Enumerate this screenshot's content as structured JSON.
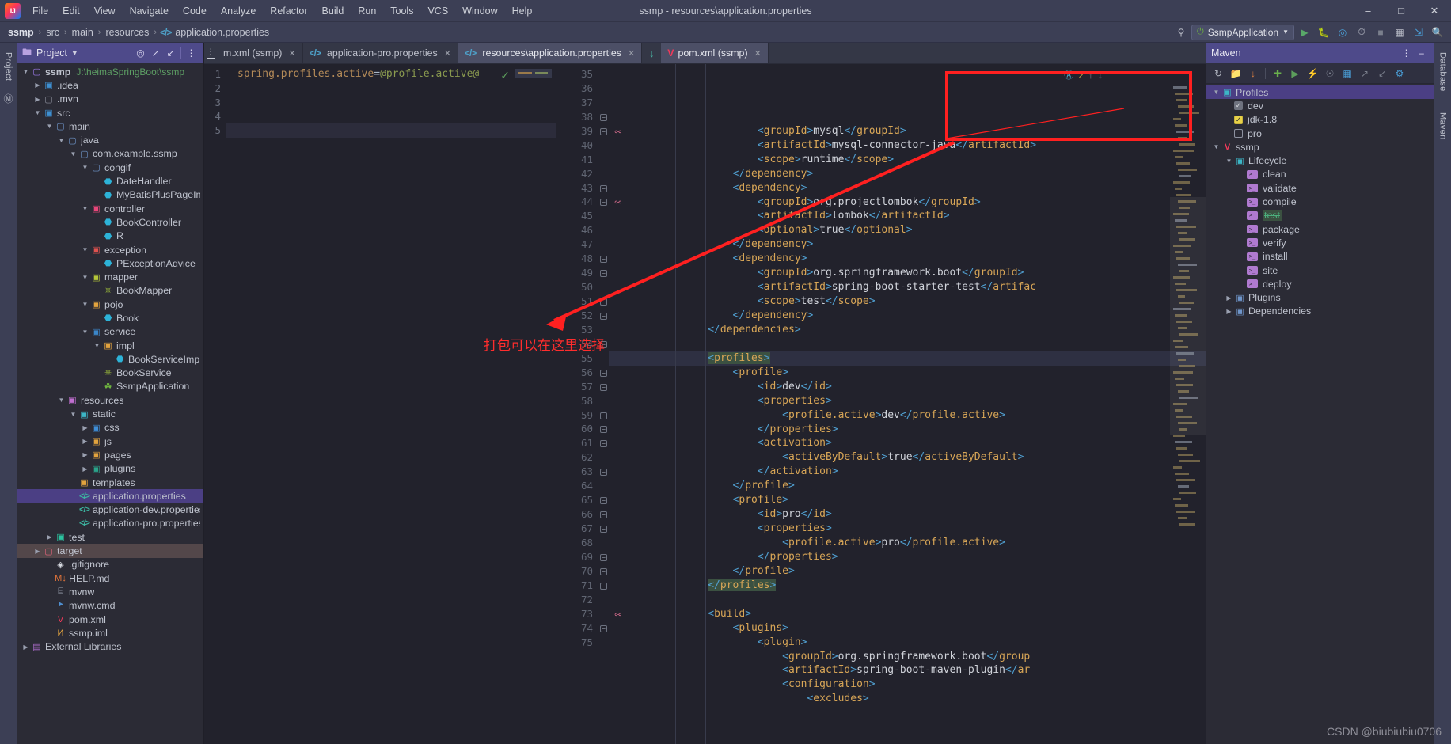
{
  "window": {
    "title": "ssmp - resources\\application.properties",
    "logo": "intellij-idea-logo",
    "controls": [
      "minimize",
      "maximize",
      "close"
    ]
  },
  "menubar": [
    "File",
    "Edit",
    "View",
    "Navigate",
    "Code",
    "Analyze",
    "Refactor",
    "Build",
    "Run",
    "Tools",
    "VCS",
    "Window",
    "Help"
  ],
  "breadcrumb": {
    "items": [
      "ssmp",
      "src",
      "main",
      "resources",
      "application.properties"
    ]
  },
  "run_toolbar": {
    "config_name": "SsmpApplication",
    "buttons": [
      "run",
      "debug",
      "run-with-coverage",
      "profiler",
      "stop",
      "layout",
      "search"
    ]
  },
  "left_stripe": {
    "tabs": [
      "Project"
    ],
    "icons": [
      "structure-icon"
    ]
  },
  "right_stripe": {
    "tabs": [
      "Database",
      "Maven"
    ]
  },
  "project_panel": {
    "title": "Project",
    "header_buttons": [
      "target-icon",
      "expand-icon",
      "collapse-icon",
      "options-icon"
    ],
    "tree": [
      {
        "depth": 0,
        "arrow": "down",
        "icon": "folder",
        "iconClass": "c-folder",
        "glyph": "▢",
        "label": "ssmp",
        "bold": true,
        "path": "J:\\heimaSpringBoot\\ssmp"
      },
      {
        "depth": 1,
        "arrow": "right",
        "icon": "folder-idea",
        "iconClass": "c-src",
        "glyph": "▣",
        "label": ".idea"
      },
      {
        "depth": 1,
        "arrow": "right",
        "icon": "folder",
        "iconClass": "c-folder2",
        "glyph": "▢",
        "label": ".mvn"
      },
      {
        "depth": 1,
        "arrow": "down",
        "icon": "source-root",
        "iconClass": "c-src",
        "glyph": "▣",
        "label": "src"
      },
      {
        "depth": 2,
        "arrow": "down",
        "icon": "folder",
        "iconClass": "c-plain",
        "glyph": "▢",
        "label": "main"
      },
      {
        "depth": 3,
        "arrow": "down",
        "icon": "folder",
        "iconClass": "c-plain",
        "glyph": "▢",
        "label": "java"
      },
      {
        "depth": 4,
        "arrow": "down",
        "icon": "package",
        "iconClass": "c-plain",
        "glyph": "▢",
        "label": "com.example.ssmp"
      },
      {
        "depth": 5,
        "arrow": "down",
        "icon": "package",
        "iconClass": "c-plain",
        "glyph": "▢",
        "label": "congif"
      },
      {
        "depth": 6,
        "arrow": "none",
        "icon": "java-class",
        "iconClass": "c-class",
        "glyph": "⬣",
        "label": "DateHandler"
      },
      {
        "depth": 6,
        "arrow": "none",
        "icon": "java-class",
        "iconClass": "c-class",
        "glyph": "⬣",
        "label": "MyBatisPlusPageInterc"
      },
      {
        "depth": 5,
        "arrow": "down",
        "icon": "folder-controller",
        "iconClass": "c-ctrl",
        "glyph": "▣",
        "label": "controller"
      },
      {
        "depth": 6,
        "arrow": "none",
        "icon": "java-class",
        "iconClass": "c-class",
        "glyph": "⬣",
        "label": "BookController"
      },
      {
        "depth": 6,
        "arrow": "none",
        "icon": "java-class",
        "iconClass": "c-class",
        "glyph": "⬣",
        "label": "R"
      },
      {
        "depth": 5,
        "arrow": "down",
        "icon": "folder-exception",
        "iconClass": "c-exc",
        "glyph": "▣",
        "label": "exception"
      },
      {
        "depth": 6,
        "arrow": "none",
        "icon": "java-class",
        "iconClass": "c-class",
        "glyph": "⬣",
        "label": "PExceptionAdvice"
      },
      {
        "depth": 5,
        "arrow": "down",
        "icon": "folder-mapper",
        "iconClass": "c-map",
        "glyph": "▣",
        "label": "mapper"
      },
      {
        "depth": 6,
        "arrow": "none",
        "icon": "java-interface",
        "iconClass": "c-iface",
        "glyph": "⎈",
        "label": "BookMapper"
      },
      {
        "depth": 5,
        "arrow": "down",
        "icon": "folder-pojo",
        "iconClass": "c-pojo",
        "glyph": "▣",
        "label": "pojo"
      },
      {
        "depth": 6,
        "arrow": "none",
        "icon": "java-class",
        "iconClass": "c-class",
        "glyph": "⬣",
        "label": "Book"
      },
      {
        "depth": 5,
        "arrow": "down",
        "icon": "folder-service",
        "iconClass": "c-svc",
        "glyph": "▣",
        "label": "service"
      },
      {
        "depth": 6,
        "arrow": "down",
        "icon": "folder-impl",
        "iconClass": "c-pojo",
        "glyph": "▣",
        "label": "impl"
      },
      {
        "depth": 7,
        "arrow": "none",
        "icon": "java-class",
        "iconClass": "c-class",
        "glyph": "⬣",
        "label": "BookServiceImpl"
      },
      {
        "depth": 6,
        "arrow": "none",
        "icon": "java-interface",
        "iconClass": "c-iface",
        "glyph": "⎈",
        "label": "BookService"
      },
      {
        "depth": 6,
        "arrow": "none",
        "icon": "spring-boot-class",
        "iconClass": "c-spring",
        "glyph": "☘",
        "label": "SsmpApplication"
      },
      {
        "depth": 3,
        "arrow": "down",
        "icon": "resources-root",
        "iconClass": "c-res",
        "glyph": "▣",
        "label": "resources"
      },
      {
        "depth": 4,
        "arrow": "down",
        "icon": "folder-static",
        "iconClass": "c-static",
        "glyph": "▣",
        "label": "static"
      },
      {
        "depth": 5,
        "arrow": "right",
        "icon": "folder-css",
        "iconClass": "c-css",
        "glyph": "▣",
        "label": "css"
      },
      {
        "depth": 5,
        "arrow": "right",
        "icon": "folder-js",
        "iconClass": "c-js",
        "glyph": "▣",
        "label": "js"
      },
      {
        "depth": 5,
        "arrow": "right",
        "icon": "folder-pages",
        "iconClass": "c-pages",
        "glyph": "▣",
        "label": "pages"
      },
      {
        "depth": 5,
        "arrow": "right",
        "icon": "folder-plugins",
        "iconClass": "c-plug",
        "glyph": "▣",
        "label": "plugins"
      },
      {
        "depth": 4,
        "arrow": "none",
        "icon": "folder-templates",
        "iconClass": "c-tmpl",
        "glyph": "▣",
        "label": "templates"
      },
      {
        "depth": 4,
        "arrow": "none",
        "icon": "properties-file",
        "iconClass": "c-prop",
        "glyph": "</>",
        "label": "application.properties",
        "selected": true
      },
      {
        "depth": 4,
        "arrow": "none",
        "icon": "properties-file",
        "iconClass": "c-prop",
        "glyph": "</>",
        "label": "application-dev.properties"
      },
      {
        "depth": 4,
        "arrow": "none",
        "icon": "properties-file",
        "iconClass": "c-prop",
        "glyph": "</>",
        "label": "application-pro.properties"
      },
      {
        "depth": 2,
        "arrow": "right",
        "icon": "test-root",
        "iconClass": "c-test",
        "glyph": "▣",
        "label": "test"
      },
      {
        "depth": 1,
        "arrow": "right",
        "icon": "folder-target",
        "iconClass": "c-target",
        "glyph": "▢",
        "label": "target",
        "selected2": true
      },
      {
        "depth": 2,
        "arrow": "none",
        "icon": "gitignore-file",
        "iconClass": "c-git",
        "glyph": "◈",
        "label": ".gitignore"
      },
      {
        "depth": 2,
        "arrow": "none",
        "icon": "markdown-file",
        "iconClass": "c-help",
        "glyph": "M↓",
        "label": "HELP.md"
      },
      {
        "depth": 2,
        "arrow": "none",
        "icon": "script-file",
        "iconClass": "c-mvnw",
        "glyph": "⌸",
        "label": "mvnw"
      },
      {
        "depth": 2,
        "arrow": "none",
        "icon": "cmd-file",
        "iconClass": "c-cmd",
        "glyph": "⯈",
        "label": "mvnw.cmd"
      },
      {
        "depth": 2,
        "arrow": "none",
        "icon": "maven-pom-file",
        "iconClass": "c-pom",
        "glyph": "V",
        "label": "pom.xml"
      },
      {
        "depth": 2,
        "arrow": "none",
        "icon": "iml-file",
        "iconClass": "c-iml",
        "glyph": "И",
        "label": "ssmp.iml"
      },
      {
        "depth": 0,
        "arrow": "right",
        "icon": "external-libraries",
        "iconClass": "c-ext",
        "glyph": "▤",
        "label": "External Libraries"
      }
    ]
  },
  "editor_tabs": [
    {
      "label": "m.xml (ssmp)",
      "icon": "maven-pom-file",
      "active": false,
      "truncated": true
    },
    {
      "label": "application-pro.properties",
      "icon": "properties-file",
      "active": false
    },
    {
      "label": "resources\\application.properties",
      "icon": "properties-file",
      "active": true
    },
    {
      "label": "pom.xml (ssmp)",
      "icon": "maven-pom-file",
      "active": true,
      "second_split": true
    }
  ],
  "left_editor": {
    "inspection_status": "ok",
    "lines": [
      {
        "n": "1",
        "prop": "spring.profiles.active",
        "eq": "=",
        "val": "@profile.active@"
      },
      {
        "n": "2",
        "prop": "",
        "eq": "",
        "val": ""
      },
      {
        "n": "3",
        "prop": "",
        "eq": "",
        "val": ""
      },
      {
        "n": "4",
        "prop": "",
        "eq": "",
        "val": ""
      },
      {
        "n": "5",
        "prop": "",
        "eq": "",
        "val": "",
        "highlighted": true
      }
    ]
  },
  "right_editor": {
    "file": "pom.xml (ssmp)",
    "warnings_count": "2",
    "lines": [
      {
        "n": "35",
        "indent": 6,
        "text": "<groupId>mysql</groupId>"
      },
      {
        "n": "36",
        "indent": 6,
        "text": "<artifactId>mysql-connector-java</artifactId>"
      },
      {
        "n": "37",
        "indent": 6,
        "text": "<scope>runtime</scope>"
      },
      {
        "n": "38",
        "indent": 5,
        "text": "</dependency>",
        "fold": true
      },
      {
        "n": "39",
        "indent": 5,
        "text": "<dependency>",
        "fold": true,
        "runmark": true
      },
      {
        "n": "40",
        "indent": 6,
        "text": "<groupId>org.projectlombok</groupId>"
      },
      {
        "n": "41",
        "indent": 6,
        "text": "<artifactId>lombok</artifactId>"
      },
      {
        "n": "42",
        "indent": 6,
        "text": "<optional>true</optional>"
      },
      {
        "n": "43",
        "indent": 5,
        "text": "</dependency>",
        "fold": true
      },
      {
        "n": "44",
        "indent": 5,
        "text": "<dependency>",
        "fold": true,
        "runmark": true
      },
      {
        "n": "45",
        "indent": 6,
        "text": "<groupId>org.springframework.boot</groupId>"
      },
      {
        "n": "46",
        "indent": 6,
        "text": "<artifactId>spring-boot-starter-test</artifac"
      },
      {
        "n": "47",
        "indent": 6,
        "text": "<scope>test</scope>"
      },
      {
        "n": "48",
        "indent": 5,
        "text": "</dependency>",
        "fold": true
      },
      {
        "n": "49",
        "indent": 4,
        "text": "</dependencies>",
        "fold": true
      },
      {
        "n": "50",
        "indent": 0,
        "text": ""
      },
      {
        "n": "51",
        "indent": 4,
        "text": "<profiles>",
        "fold": true,
        "rowHighlight": true,
        "boxHighlight": true
      },
      {
        "n": "52",
        "indent": 5,
        "text": "<profile>",
        "fold": true
      },
      {
        "n": "53",
        "indent": 6,
        "text": "<id>dev</id>"
      },
      {
        "n": "54",
        "indent": 6,
        "text": "<properties>",
        "fold": true
      },
      {
        "n": "55",
        "indent": 7,
        "text": "<profile.active>dev</profile.active>"
      },
      {
        "n": "56",
        "indent": 6,
        "text": "</properties>",
        "fold": true
      },
      {
        "n": "57",
        "indent": 6,
        "text": "<activation>",
        "fold": true
      },
      {
        "n": "58",
        "indent": 7,
        "text": "<activeByDefault>true</activeByDefault>"
      },
      {
        "n": "59",
        "indent": 6,
        "text": "</activation>",
        "fold": true
      },
      {
        "n": "60",
        "indent": 5,
        "text": "</profile>",
        "fold": true
      },
      {
        "n": "61",
        "indent": 5,
        "text": "<profile>",
        "fold": true
      },
      {
        "n": "62",
        "indent": 6,
        "text": "<id>pro</id>"
      },
      {
        "n": "63",
        "indent": 6,
        "text": "<properties>",
        "fold": true
      },
      {
        "n": "64",
        "indent": 7,
        "text": "<profile.active>pro</profile.active>"
      },
      {
        "n": "65",
        "indent": 6,
        "text": "</properties>",
        "fold": true
      },
      {
        "n": "66",
        "indent": 5,
        "text": "</profile>",
        "fold": true
      },
      {
        "n": "67",
        "indent": 4,
        "text": "</profiles>",
        "fold": true,
        "boxHighlight": true
      },
      {
        "n": "68",
        "indent": 0,
        "text": ""
      },
      {
        "n": "69",
        "indent": 4,
        "text": "<build>",
        "fold": true
      },
      {
        "n": "70",
        "indent": 5,
        "text": "<plugins>",
        "fold": true
      },
      {
        "n": "71",
        "indent": 6,
        "text": "<plugin>",
        "fold": true
      },
      {
        "n": "72",
        "indent": 7,
        "text": "<groupId>org.springframework.boot</group"
      },
      {
        "n": "73",
        "indent": 7,
        "text": "<artifactId>spring-boot-maven-plugin</ar",
        "runmark": true
      },
      {
        "n": "74",
        "indent": 7,
        "text": "<configuration>",
        "fold": true
      },
      {
        "n": "75",
        "indent": 8,
        "text": "<excludes>"
      }
    ]
  },
  "maven_panel": {
    "title": "Maven",
    "toolbar_buttons": [
      "reload-icon",
      "add-folder-icon",
      "download-sources-icon",
      "add-icon",
      "run-icon",
      "skip-tests-icon",
      "toggle-offline-icon",
      "profiles-icon",
      "expand-icon",
      "collapse-icon",
      "settings-icon"
    ],
    "tree": [
      {
        "depth": 0,
        "arrow": "down",
        "icon": "profiles-folder-icon",
        "label": "Profiles",
        "selected": true
      },
      {
        "depth": 1,
        "arrow": "none",
        "checkbox": "checked-gray",
        "label": "dev"
      },
      {
        "depth": 1,
        "arrow": "none",
        "checkbox": "checked-yellow",
        "label": "jdk-1.8"
      },
      {
        "depth": 1,
        "arrow": "none",
        "checkbox": "unchecked",
        "label": "pro"
      },
      {
        "depth": 0,
        "arrow": "down",
        "icon": "maven-project-icon",
        "label": "ssmp"
      },
      {
        "depth": 1,
        "arrow": "down",
        "icon": "lifecycle-folder-icon",
        "label": "Lifecycle"
      },
      {
        "depth": 2,
        "arrow": "none",
        "icon": "goal-icon",
        "label": "clean"
      },
      {
        "depth": 2,
        "arrow": "none",
        "icon": "goal-icon",
        "label": "validate"
      },
      {
        "depth": 2,
        "arrow": "none",
        "icon": "goal-icon",
        "label": "compile"
      },
      {
        "depth": 2,
        "arrow": "none",
        "icon": "goal-icon",
        "label": "test",
        "struck": true
      },
      {
        "depth": 2,
        "arrow": "none",
        "icon": "goal-icon",
        "label": "package"
      },
      {
        "depth": 2,
        "arrow": "none",
        "icon": "goal-icon",
        "label": "verify"
      },
      {
        "depth": 2,
        "arrow": "none",
        "icon": "goal-icon",
        "label": "install"
      },
      {
        "depth": 2,
        "arrow": "none",
        "icon": "goal-icon",
        "label": "site"
      },
      {
        "depth": 2,
        "arrow": "none",
        "icon": "goal-icon",
        "label": "deploy"
      },
      {
        "depth": 1,
        "arrow": "right",
        "icon": "plugins-folder-icon",
        "label": "Plugins"
      },
      {
        "depth": 1,
        "arrow": "right",
        "icon": "dependencies-folder-icon",
        "label": "Dependencies"
      }
    ]
  },
  "annotation": {
    "text": "打包可以在这里选择",
    "color": "#ff2d2d"
  },
  "watermark": "CSDN @biubiubiu0706"
}
